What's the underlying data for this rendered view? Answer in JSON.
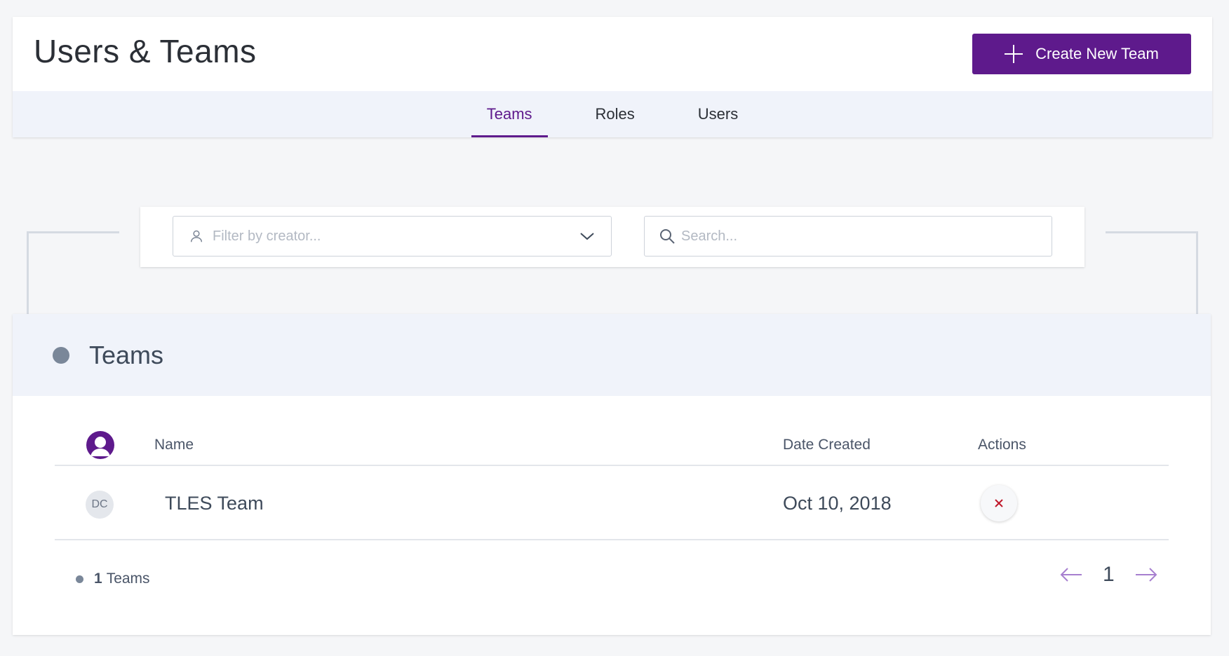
{
  "header": {
    "title": "Users & Teams",
    "create_button_label": "Create New Team"
  },
  "tabs": [
    {
      "label": "Teams",
      "active": true
    },
    {
      "label": "Roles",
      "active": false
    },
    {
      "label": "Users",
      "active": false
    }
  ],
  "filters": {
    "creator_placeholder": "Filter by creator...",
    "search_placeholder": "Search..."
  },
  "teams_section": {
    "title": "Teams",
    "columns": {
      "name": "Name",
      "date_created": "Date Created",
      "actions": "Actions"
    },
    "rows": [
      {
        "avatar_initials": "DC",
        "name": "TLES Team",
        "date_created": "Oct 10, 2018"
      }
    ],
    "footer": {
      "count": "1",
      "count_label": "Teams"
    },
    "pagination": {
      "current_page": "1"
    }
  },
  "colors": {
    "accent": "#5e1a8c",
    "header_band": "#f0f3fa",
    "delete_icon": "#c0182b",
    "pagination_arrow": "#a77fcf"
  },
  "icons": {
    "create": "plus-icon",
    "creator_filter": "user-icon",
    "dropdown": "chevron-down-icon",
    "search": "search-icon",
    "delete": "close-icon",
    "prev": "arrow-left-icon",
    "next": "arrow-right-icon"
  }
}
